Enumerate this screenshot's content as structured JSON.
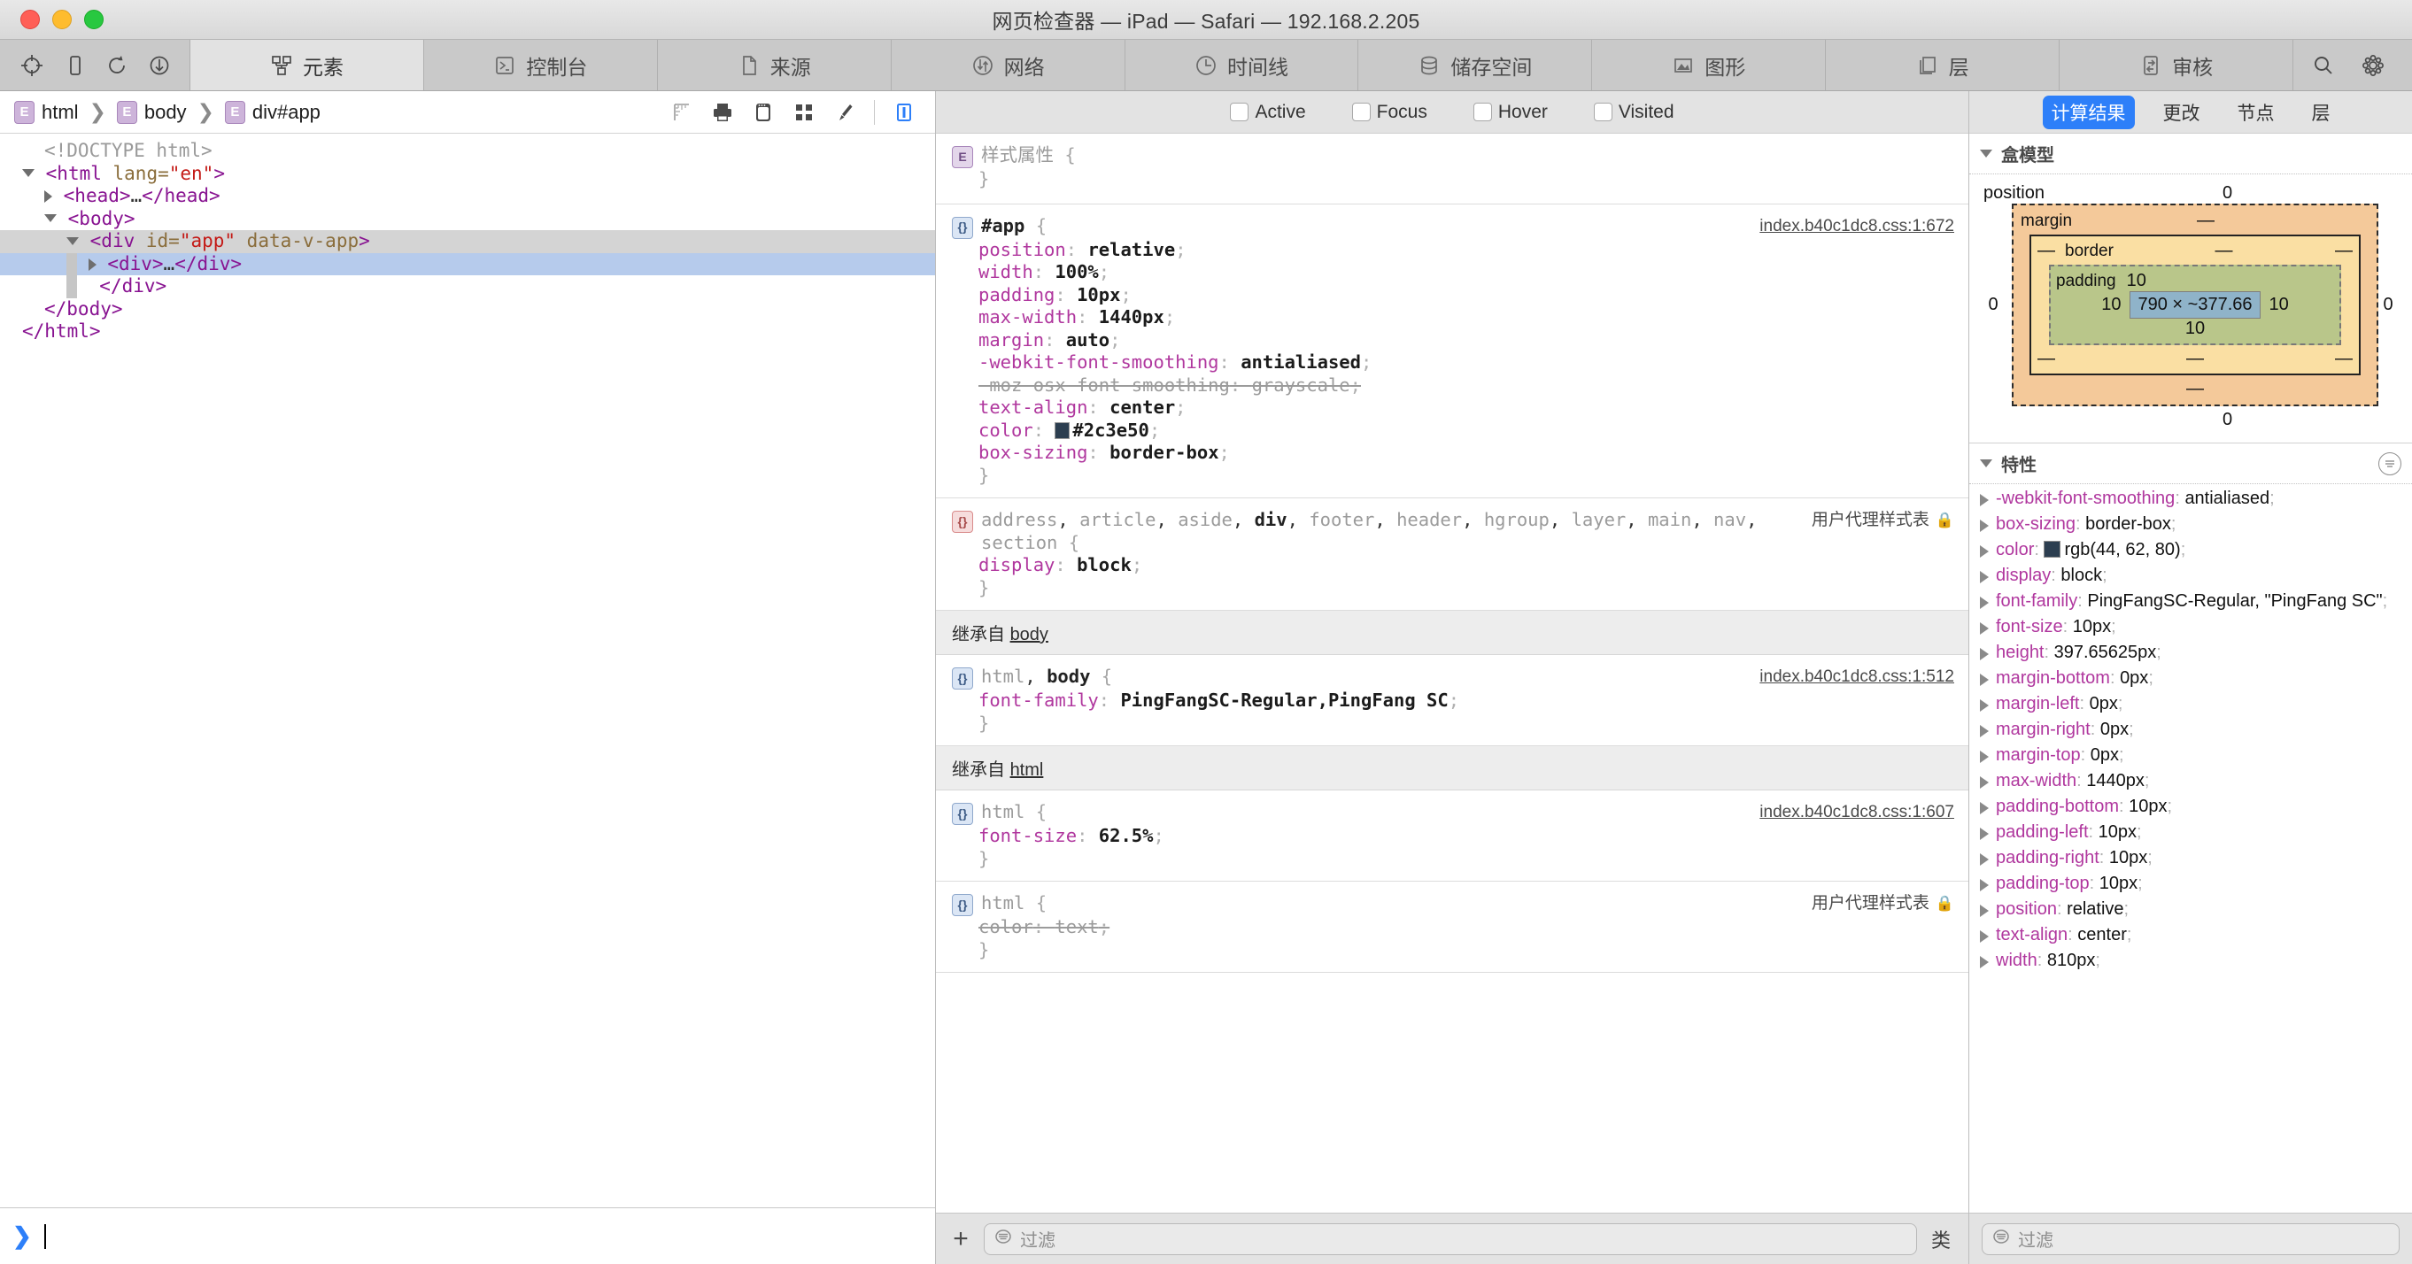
{
  "window": {
    "title": "网页检查器 — iPad — Safari — 192.168.2.205",
    "traffic": {
      "close": "close-button",
      "minimize": "minimize-button",
      "zoom": "zoom-button"
    }
  },
  "toolbar": {
    "left_icons": [
      "inspect-element-icon",
      "device-icon",
      "reload-icon",
      "download-icon"
    ],
    "tabs": [
      {
        "label": "元素",
        "icon": "elements-icon",
        "active": true
      },
      {
        "label": "控制台",
        "icon": "console-icon",
        "active": false
      },
      {
        "label": "来源",
        "icon": "sources-icon",
        "active": false
      },
      {
        "label": "网络",
        "icon": "network-icon",
        "active": false
      },
      {
        "label": "时间线",
        "icon": "timeline-icon",
        "active": false
      },
      {
        "label": "储存空间",
        "icon": "storage-icon",
        "active": false
      },
      {
        "label": "图形",
        "icon": "graphics-icon",
        "active": false
      },
      {
        "label": "层",
        "icon": "layers-icon",
        "active": false
      },
      {
        "label": "审核",
        "icon": "audit-icon",
        "active": false
      }
    ],
    "right_icons": [
      "search-icon",
      "gear-icon"
    ]
  },
  "dom_panel": {
    "breadcrumb": [
      {
        "badge": "E",
        "label": "html"
      },
      {
        "badge": "E",
        "label": "body"
      },
      {
        "badge": "E",
        "label": "div#app"
      }
    ],
    "separator": "❯",
    "tools": [
      "ruler-icon",
      "print-icon",
      "browser-icon",
      "grid-icon",
      "paintbrush-icon",
      "sidebar-toggle-icon"
    ],
    "tree": [
      {
        "indent": 1,
        "arrow": "none",
        "parts": [
          {
            "t": "doctype",
            "v": "<!DOCTYPE html>"
          }
        ]
      },
      {
        "indent": 0,
        "arrow": "down",
        "parts": [
          {
            "t": "tag",
            "v": "<html "
          },
          {
            "t": "attr",
            "v": "lang="
          },
          {
            "t": "val",
            "v": "\"en\""
          },
          {
            "t": "tag",
            "v": ">"
          }
        ]
      },
      {
        "indent": 1,
        "arrow": "right",
        "parts": [
          {
            "t": "tag",
            "v": "<head>"
          },
          {
            "t": "text",
            "v": "…"
          },
          {
            "t": "tag",
            "v": "</head>"
          }
        ]
      },
      {
        "indent": 1,
        "arrow": "down",
        "parts": [
          {
            "t": "tag",
            "v": "<body>"
          }
        ]
      },
      {
        "indent": 2,
        "arrow": "down",
        "state": "sel-parent",
        "parts": [
          {
            "t": "tag",
            "v": "<div "
          },
          {
            "t": "attr",
            "v": "id="
          },
          {
            "t": "val",
            "v": "\"app\""
          },
          {
            "t": "attr",
            "v": " data-v-app"
          },
          {
            "t": "tag",
            "v": ">"
          }
        ]
      },
      {
        "indent": 3,
        "arrow": "right",
        "state": "sel",
        "guide": true,
        "parts": [
          {
            "t": "tag",
            "v": "<div>"
          },
          {
            "t": "text",
            "v": "…"
          },
          {
            "t": "tag",
            "v": "</div>"
          }
        ]
      },
      {
        "indent": 3,
        "arrow": "none",
        "guide": true,
        "parts": [
          {
            "t": "tag",
            "v": "</div>"
          }
        ]
      },
      {
        "indent": 2,
        "arrow": "none",
        "parts": [
          {
            "t": "tag",
            "v": "</body>"
          }
        ]
      },
      {
        "indent": 1,
        "arrow": "none",
        "parts": [
          {
            "t": "tag",
            "v": "</html>"
          }
        ]
      }
    ],
    "console_prompt": {
      "chevron": "❯"
    }
  },
  "styles_panel": {
    "pseudo_classes": [
      {
        "label": "Active",
        "checked": false
      },
      {
        "label": "Focus",
        "checked": false
      },
      {
        "label": "Hover",
        "checked": false
      },
      {
        "label": "Visited",
        "checked": false
      }
    ],
    "rules": [
      {
        "kind": "inline",
        "badge": "E",
        "badge_kind": "element",
        "selector": "样式属性",
        "origin": "",
        "declarations": []
      },
      {
        "kind": "css",
        "badge": "{}",
        "badge_kind": "css",
        "selector": "#app",
        "selector_bold": true,
        "origin": "index.b40c1dc8.css:1:672",
        "declarations": [
          {
            "prop": "position",
            "value": "relative"
          },
          {
            "prop": "width",
            "value": "100%"
          },
          {
            "prop": "padding",
            "value": "10px"
          },
          {
            "prop": "max-width",
            "value": "1440px"
          },
          {
            "prop": "margin",
            "value": "auto"
          },
          {
            "prop": "-webkit-font-smoothing",
            "value": "antialiased"
          },
          {
            "prop": "-moz-osx-font-smoothing",
            "value": "grayscale",
            "disabled": true
          },
          {
            "prop": "text-align",
            "value": "center"
          },
          {
            "prop": "color",
            "value": "#2c3e50",
            "swatch": "#2c3e50"
          },
          {
            "prop": "box-sizing",
            "value": "border-box"
          }
        ]
      },
      {
        "kind": "ua",
        "badge": "{}",
        "badge_kind": "ua",
        "selector_parts": [
          {
            "t": "dim",
            "v": "address"
          },
          {
            "t": "punc",
            "v": ", "
          },
          {
            "t": "dim",
            "v": "article"
          },
          {
            "t": "punc",
            "v": ", "
          },
          {
            "t": "dim",
            "v": "aside"
          },
          {
            "t": "punc",
            "v": ", "
          },
          {
            "t": "bold",
            "v": "div"
          },
          {
            "t": "punc",
            "v": ", "
          },
          {
            "t": "dim",
            "v": "footer"
          },
          {
            "t": "punc",
            "v": ", "
          },
          {
            "t": "dim",
            "v": "header"
          },
          {
            "t": "punc",
            "v": ", "
          },
          {
            "t": "dim",
            "v": "hgroup"
          },
          {
            "t": "punc",
            "v": ", "
          },
          {
            "t": "dim",
            "v": "layer"
          },
          {
            "t": "punc",
            "v": ", "
          },
          {
            "t": "dim",
            "v": "main"
          },
          {
            "t": "punc",
            "v": ", "
          },
          {
            "t": "dim",
            "v": "nav"
          },
          {
            "t": "punc",
            "v": ", "
          },
          {
            "t": "dim",
            "v": "section"
          }
        ],
        "origin": "用户代理样式表",
        "locked": true,
        "declarations": [
          {
            "prop": "display",
            "value": "block"
          }
        ]
      },
      {
        "kind": "inherit-header",
        "text": "继承自",
        "link": "body"
      },
      {
        "kind": "css",
        "badge": "{}",
        "badge_kind": "css",
        "selector_parts": [
          {
            "t": "dim",
            "v": "html"
          },
          {
            "t": "punc",
            "v": ", "
          },
          {
            "t": "bold",
            "v": "body"
          }
        ],
        "origin": "index.b40c1dc8.css:1:512",
        "declarations": [
          {
            "prop": "font-family",
            "value": "PingFangSC-Regular,PingFang SC"
          }
        ]
      },
      {
        "kind": "inherit-header",
        "text": "继承自",
        "link": "html"
      },
      {
        "kind": "css",
        "badge": "{}",
        "badge_kind": "css",
        "selector": "html",
        "selector_bold": false,
        "origin": "index.b40c1dc8.css:1:607",
        "declarations": [
          {
            "prop": "font-size",
            "value": "62.5%"
          }
        ]
      },
      {
        "kind": "ua",
        "badge": "{}",
        "badge_kind": "css",
        "selector": "html",
        "selector_bold": false,
        "origin": "用户代理样式表",
        "locked": true,
        "declarations": [
          {
            "prop": "color",
            "value": "text",
            "disabled": true
          }
        ]
      }
    ],
    "filter_bar": {
      "add_label": "+",
      "filter_placeholder": "过滤",
      "class_label": "类"
    }
  },
  "right_panel": {
    "tabs": [
      {
        "label": "计算结果",
        "active": true
      },
      {
        "label": "更改",
        "active": false
      },
      {
        "label": "节点",
        "active": false
      },
      {
        "label": "层",
        "active": false
      }
    ],
    "box_model": {
      "section_title": "盒模型",
      "position_label": "position",
      "position": {
        "top": "0",
        "right": "0",
        "bottom": "0",
        "left": "0"
      },
      "margin_label": "margin",
      "margin": {
        "top": "—",
        "right": "—",
        "bottom": "—",
        "left": "—"
      },
      "border_label": "border",
      "border": {
        "top": "—",
        "right": "—",
        "bottom": "—",
        "left": "—"
      },
      "padding_label": "padding",
      "padding": {
        "top": "10",
        "right": "10",
        "bottom": "10",
        "left": "10"
      },
      "content": "790 × ~377.66",
      "colors": {
        "margin": "#f4c99a",
        "border": "#fadfa3",
        "padding": "#b9c68a",
        "content": "#8fb3c9"
      }
    },
    "properties": {
      "section_title": "特性",
      "filter_icon": "filter-icon",
      "items": [
        {
          "name": "-webkit-font-smoothing",
          "value": "antialiased"
        },
        {
          "name": "box-sizing",
          "value": "border-box"
        },
        {
          "name": "color",
          "value": "rgb(44, 62, 80)",
          "swatch": "#2c3e50"
        },
        {
          "name": "display",
          "value": "block"
        },
        {
          "name": "font-family",
          "value": "PingFangSC-Regular, \"PingFang SC\""
        },
        {
          "name": "font-size",
          "value": "10px"
        },
        {
          "name": "height",
          "value": "397.65625px"
        },
        {
          "name": "margin-bottom",
          "value": "0px"
        },
        {
          "name": "margin-left",
          "value": "0px"
        },
        {
          "name": "margin-right",
          "value": "0px"
        },
        {
          "name": "margin-top",
          "value": "0px"
        },
        {
          "name": "max-width",
          "value": "1440px"
        },
        {
          "name": "padding-bottom",
          "value": "10px"
        },
        {
          "name": "padding-left",
          "value": "10px"
        },
        {
          "name": "padding-right",
          "value": "10px"
        },
        {
          "name": "padding-top",
          "value": "10px"
        },
        {
          "name": "position",
          "value": "relative"
        },
        {
          "name": "text-align",
          "value": "center"
        },
        {
          "name": "width",
          "value": "810px"
        }
      ]
    },
    "filter_bar": {
      "filter_placeholder": "过滤"
    }
  },
  "colors": {
    "accent": "#2d7ff9",
    "selection": "#b6cbec",
    "parent_selection": "#d4d4d4"
  }
}
